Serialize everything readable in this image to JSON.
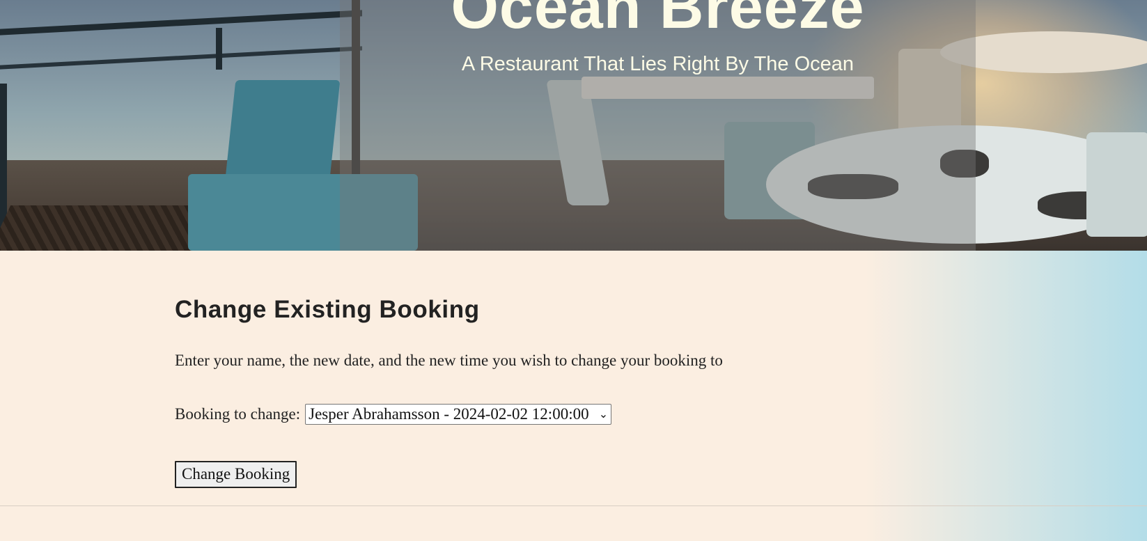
{
  "hero": {
    "brand": "Ocean Breeze",
    "tagline": "A Restaurant That Lies Right By The Ocean",
    "image_description_icon": "restaurant-terrace-photo"
  },
  "main": {
    "title": "Change Existing Booking",
    "intro": "Enter your name, the new date, and the new time you wish to change your booking to",
    "booking_label": "Booking to change:",
    "booking_selected": "Jesper Abrahamsson - 2024-02-02 12:00:00",
    "submit_label": "Change Booking"
  },
  "colors": {
    "page_bg": "#fbeee1",
    "page_bg_edge": "#b3dde8",
    "hero_text": "#fdfbe6",
    "text": "#222222"
  }
}
